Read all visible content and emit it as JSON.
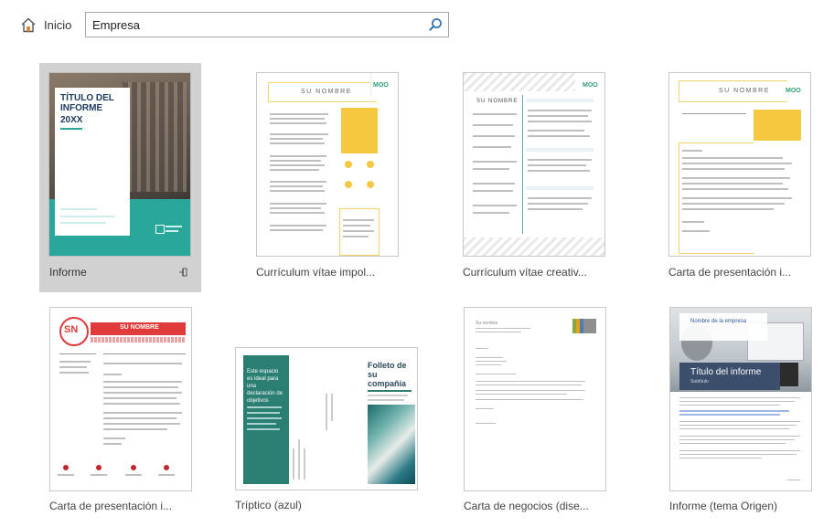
{
  "nav": {
    "home_label": "Inicio"
  },
  "search": {
    "value": "Empresa"
  },
  "templates": [
    {
      "label": "Informe",
      "thumb_title": "TÍTULO DEL INFORME",
      "thumb_year": "20XX"
    },
    {
      "label": "Currículum vítae impol...",
      "thumb_name": "SU NOMBRE",
      "thumb_logo": "MOO"
    },
    {
      "label": "Currículum vítae creativ...",
      "thumb_name": "SU NOMBRE",
      "thumb_logo": "MOO"
    },
    {
      "label": "Carta de presentación i...",
      "thumb_name": "SU NOMBRE",
      "thumb_logo": "MOO"
    },
    {
      "label": "Carta de presentación i...",
      "thumb_initials": "SN",
      "thumb_name": "SU NOMBRE"
    },
    {
      "label": "Tríptico (azul)",
      "thumb_title": "Folleto de su compañía",
      "thumb_panel": "Este espacio es ideal para una declaración de objetivos"
    },
    {
      "label": "Carta de negocios (dise...",
      "thumb_text": "Su nombre"
    },
    {
      "label": "Informe (tema Origen)",
      "thumb_company": "Nombre de la empresa",
      "thumb_title": "Título del informe",
      "thumb_subtitle": "Subtítulo"
    }
  ]
}
